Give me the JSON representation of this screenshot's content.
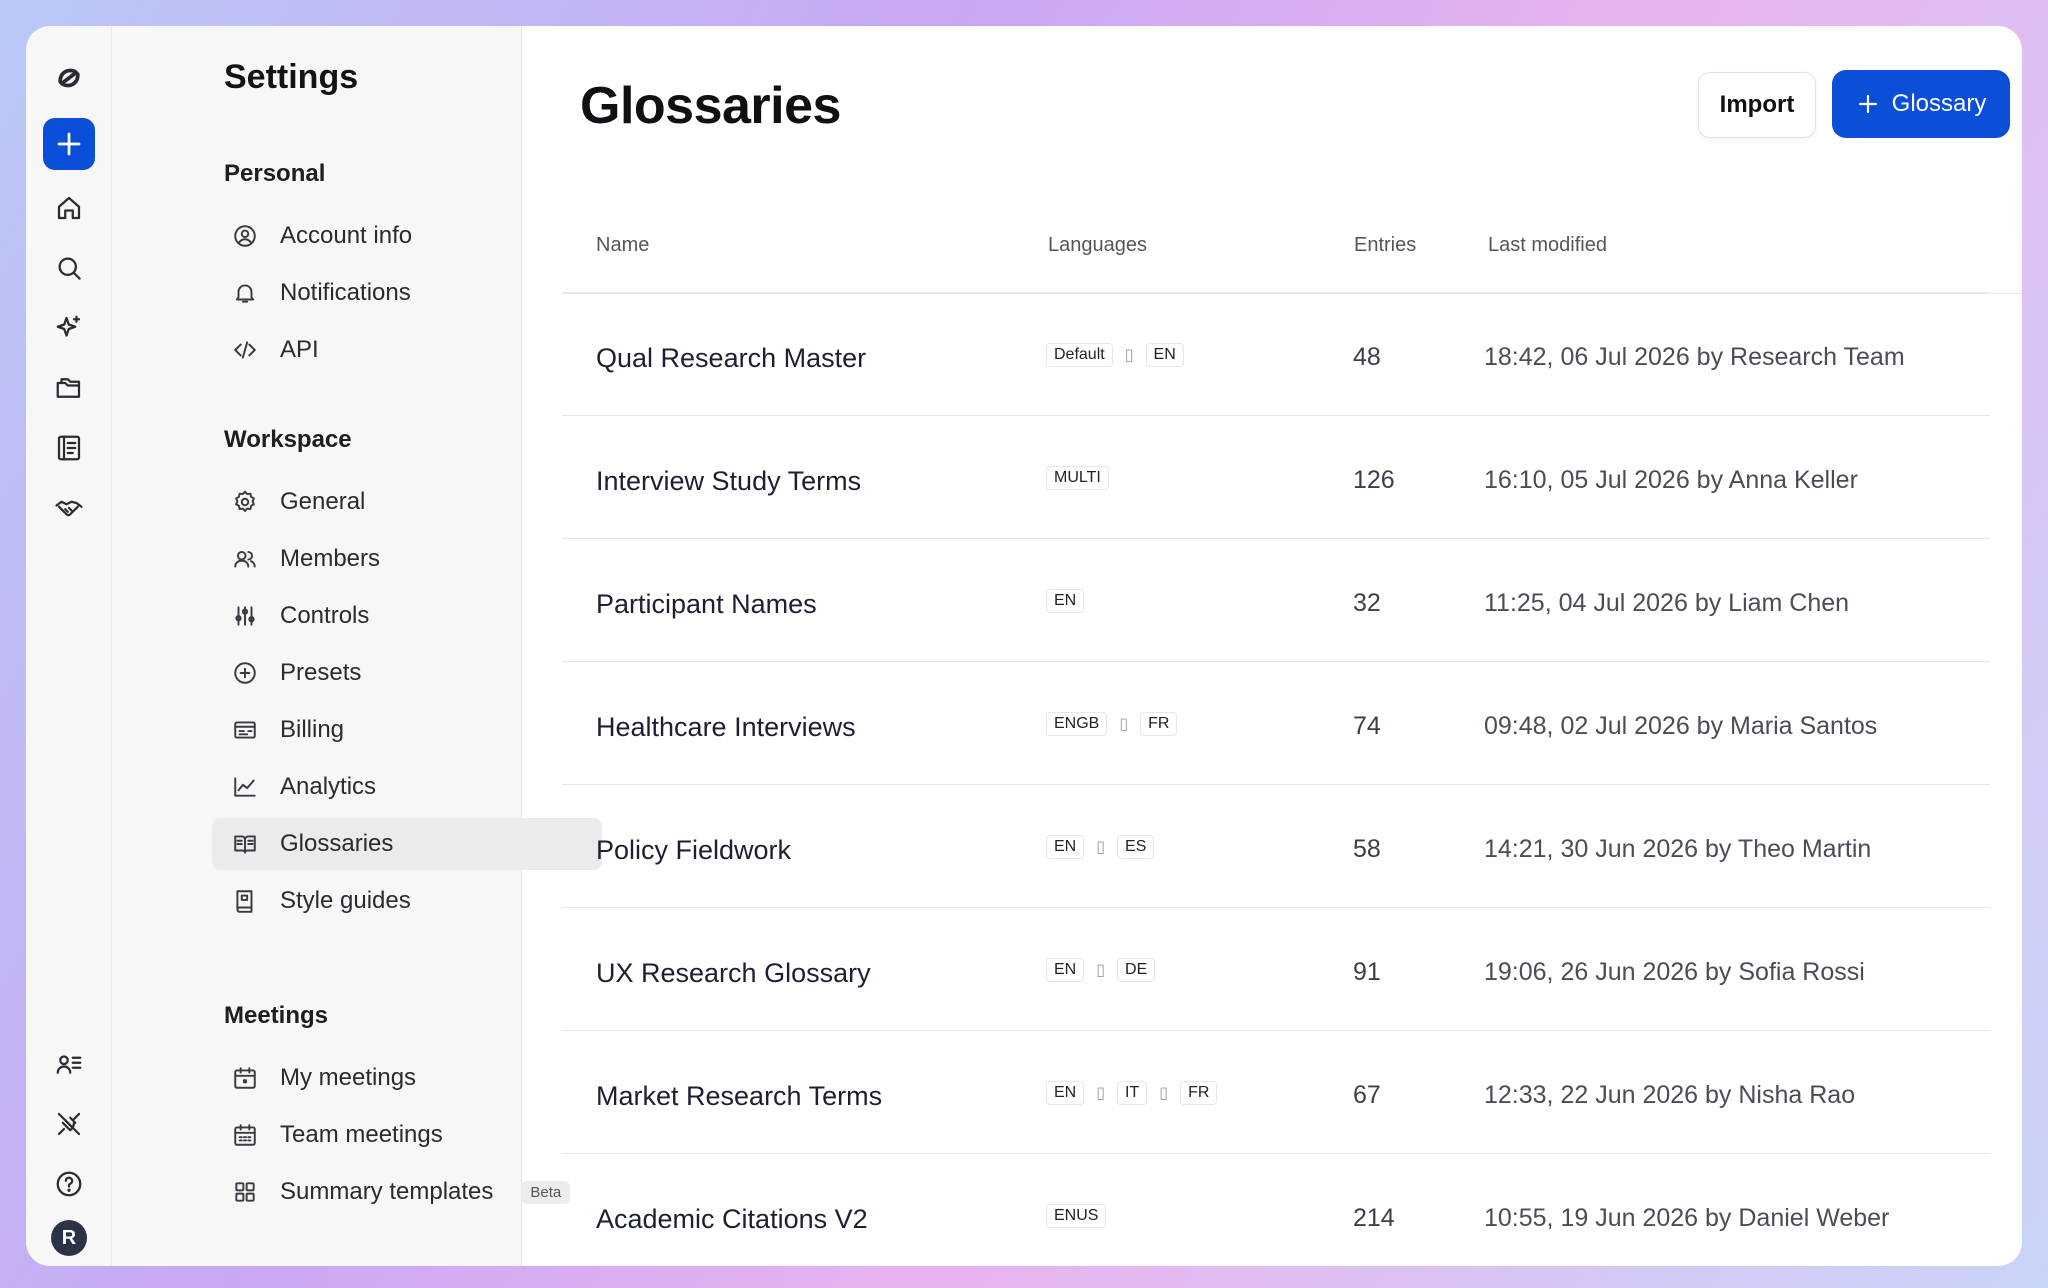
{
  "sidebar": {
    "title": "Settings",
    "sections": [
      {
        "label": "Personal"
      },
      {
        "label": "Workspace"
      },
      {
        "label": "Meetings"
      }
    ],
    "items": [
      {
        "label": "Account info",
        "icon": "user-circle-icon"
      },
      {
        "label": "Notifications",
        "icon": "bell-icon"
      },
      {
        "label": "API",
        "icon": "code-icon"
      },
      {
        "label": "General",
        "icon": "gear-icon"
      },
      {
        "label": "Members",
        "icon": "users-icon"
      },
      {
        "label": "Controls",
        "icon": "sliders-icon"
      },
      {
        "label": "Presets",
        "icon": "plus-circle-icon"
      },
      {
        "label": "Billing",
        "icon": "receipt-icon"
      },
      {
        "label": "Analytics",
        "icon": "chart-line-icon"
      },
      {
        "label": "Glossaries",
        "icon": "book-open-icon"
      },
      {
        "label": "Style guides",
        "icon": "book-icon"
      },
      {
        "label": "My meetings",
        "icon": "calendar-icon"
      },
      {
        "label": "Team meetings",
        "icon": "calendar-grid-icon"
      },
      {
        "label": "Summary templates",
        "icon": "grid-icon",
        "badge": "Beta"
      }
    ],
    "active": "Glossaries"
  },
  "rail": {
    "avatar_initial": "R"
  },
  "main": {
    "title": "Glossaries",
    "import_label": "Import",
    "new_label": "Glossary",
    "columns": {
      "name": "Name",
      "languages": "Languages",
      "entries": "Entries",
      "modified": "Last modified"
    },
    "rows": [
      {
        "name": "Qual Research Master",
        "langs": [
          "Default",
          "EN"
        ],
        "entries": "48",
        "modified": "18:42, 06 Jul 2026 by Research Team"
      },
      {
        "name": "Interview Study Terms",
        "langs": [
          "MULTI"
        ],
        "entries": "126",
        "modified": "16:10, 05 Jul 2026 by Anna Keller"
      },
      {
        "name": "Participant Names",
        "langs": [
          "EN"
        ],
        "entries": "32",
        "modified": "11:25, 04 Jul 2026 by Liam Chen"
      },
      {
        "name": "Healthcare Interviews",
        "langs": [
          "ENGB",
          "FR"
        ],
        "entries": "74",
        "modified": "09:48, 02 Jul 2026 by Maria Santos"
      },
      {
        "name": "Policy Fieldwork",
        "langs": [
          "EN",
          "ES"
        ],
        "entries": "58",
        "modified": "14:21, 30 Jun 2026 by Theo Martin"
      },
      {
        "name": "UX Research Glossary",
        "langs": [
          "EN",
          "DE"
        ],
        "entries": "91",
        "modified": "19:06, 26 Jun 2026 by Sofia Rossi"
      },
      {
        "name": "Market Research Terms",
        "langs": [
          "EN",
          "IT",
          "FR"
        ],
        "entries": "67",
        "modified": "12:33, 22 Jun 2026 by Nisha Rao"
      },
      {
        "name": "Academic Citations V2",
        "langs": [
          "ENUS"
        ],
        "entries": "214",
        "modified": "10:55, 19 Jun 2026 by Daniel Weber"
      }
    ],
    "lang_separator": "▯"
  },
  "colors": {
    "accent": "#0b4fd9",
    "active_item_bg": "#ebebee"
  }
}
